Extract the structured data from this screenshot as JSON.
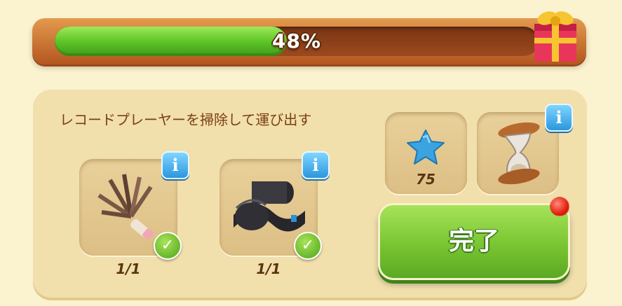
{
  "progress": {
    "percent_label": "48%",
    "value": 0.48
  },
  "task": {
    "title": "レコードプレーヤーを掃除して運び出す",
    "items": [
      {
        "name": "feather-duster",
        "count": "1/1",
        "completed": true
      },
      {
        "name": "vinyl-records",
        "count": "1/1",
        "completed": true
      }
    ]
  },
  "reward": {
    "star_count": "75"
  },
  "actions": {
    "complete_label": "完了"
  },
  "icons": {
    "info": "i",
    "check": "✓"
  },
  "colors": {
    "progress_fill": "#63c92b",
    "button_green": "#79c531",
    "info_blue": "#2a97de",
    "title_brown": "#7a3f12"
  }
}
